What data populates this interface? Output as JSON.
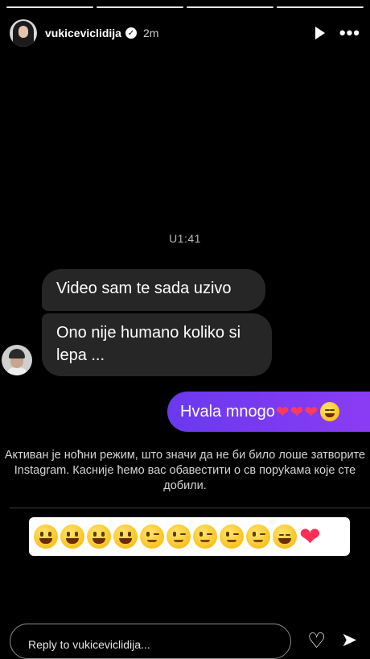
{
  "story": {
    "progress_segments": 4,
    "username": "vukiceviclidija",
    "verified_mark": "✓",
    "time_ago": "2m",
    "actions": [
      "play-icon",
      "more-icon"
    ],
    "more_glyph": "•••"
  },
  "screenshot": {
    "timestamp": "U1:41",
    "received_messages": [
      "Video sam te sada uzivo",
      "Ono nije humano koliko si lepa ..."
    ],
    "sent_message": {
      "text": "Hvala mnogo",
      "trailing_emoji": [
        "heart",
        "heart",
        "heart",
        "smiling-face-with-hearts"
      ]
    },
    "night_mode_notice": "Активан је ноћни режим, што значи да не би било лоше затворите Instagram. Касније ћемо вас обавестити о св поруkама које сте добили.",
    "emoji_sticker": [
      "grinning",
      "grinning",
      "grinning",
      "grinning",
      "winking",
      "winking",
      "winking",
      "winking",
      "winking",
      "smiling-face-with-hearts",
      "red-heart"
    ]
  },
  "reply_bar": {
    "placeholder": "Reply to vukiceviclidija...",
    "like_glyph": "♡",
    "send_glyph": "➤"
  },
  "colors": {
    "background": "#000000",
    "received_bubble": "#262626",
    "sent_bubble_start": "#6a39ee",
    "sent_bubble_end": "#8b3cf4",
    "heart": "#ff3b5c"
  }
}
